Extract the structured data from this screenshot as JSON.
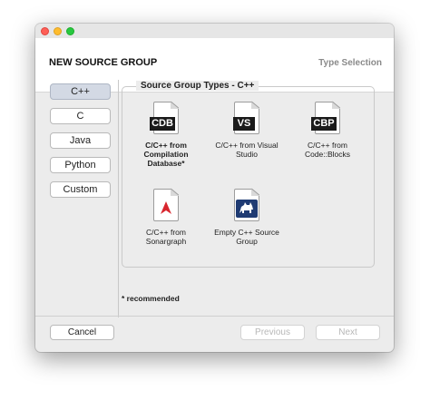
{
  "dialog": {
    "title": "NEW SOURCE GROUP",
    "step_label": "Type Selection"
  },
  "languages": [
    {
      "label": "C++",
      "selected": true
    },
    {
      "label": "C",
      "selected": false
    },
    {
      "label": "Java",
      "selected": false
    },
    {
      "label": "Python",
      "selected": false
    },
    {
      "label": "Custom",
      "selected": false
    }
  ],
  "panel": {
    "title": "Source Group Types - C++"
  },
  "types": [
    {
      "icon": "cdb-file-icon",
      "badge": "CDB",
      "caption": "C/C++ from Compilation Database*",
      "bold": true
    },
    {
      "icon": "visual-studio-file-icon",
      "badge": "VS",
      "caption": "C/C++ from Visual Studio",
      "bold": false
    },
    {
      "icon": "cbp-file-icon",
      "badge": "CBP",
      "caption": "C/C++ from Code::Blocks",
      "bold": false
    },
    {
      "icon": "sonargraph-file-icon",
      "badge": "",
      "caption": "C/C++ from Sonargraph",
      "bold": false
    },
    {
      "icon": "sourcetrail-file-icon",
      "badge": "",
      "caption": "Empty C++ Source Group",
      "bold": false
    }
  ],
  "footnote": "* recommended",
  "buttons": {
    "cancel": "Cancel",
    "previous": "Previous",
    "next": "Next"
  },
  "colors": {
    "selected_language_bg": "#d3d9e4",
    "sonargraph_red": "#d8262e",
    "sourcetrail_blue": "#1f3b73"
  }
}
